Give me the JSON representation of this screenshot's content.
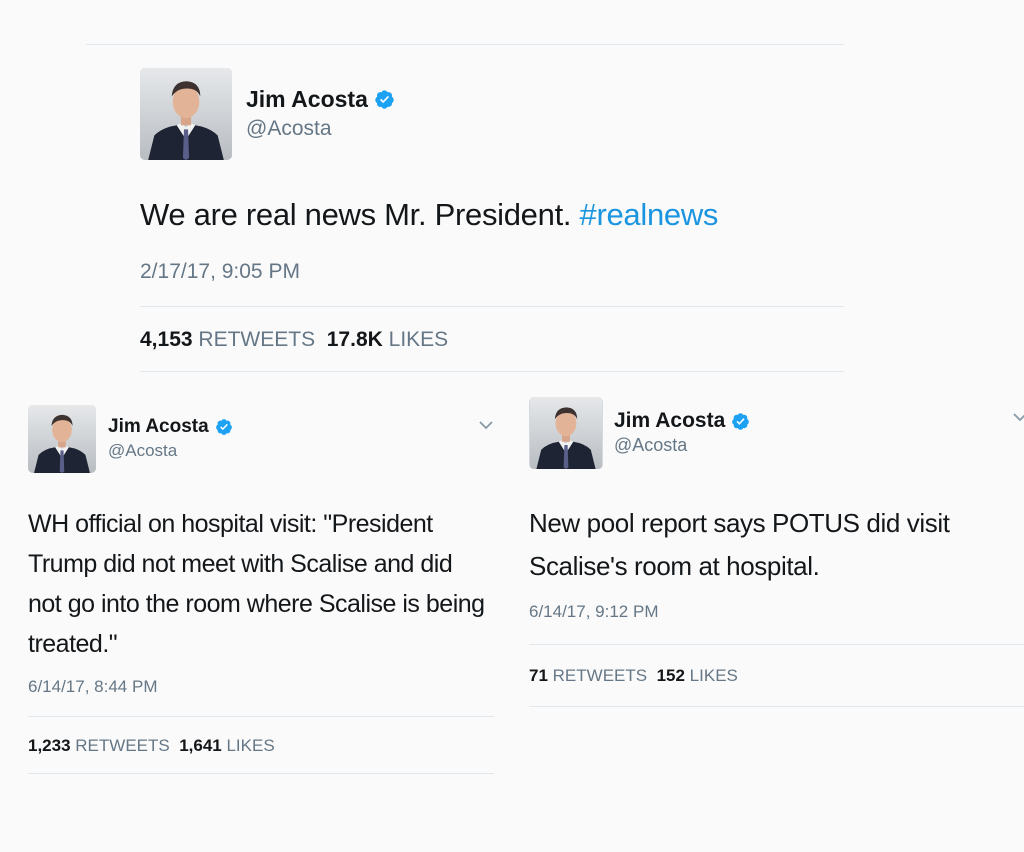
{
  "tweets": [
    {
      "name": "Jim Acosta",
      "handle": "@Acosta",
      "text": "We are real news Mr. President.",
      "hashtag": "#realnews",
      "timestamp": "2/17/17, 9:05 PM",
      "retweets": "4,153",
      "retweets_label": "RETWEETS",
      "likes": "17.8K",
      "likes_label": "LIKES",
      "verified_icon": "verified-badge-icon"
    },
    {
      "name": "Jim Acosta",
      "handle": "@Acosta",
      "text": "WH official on hospital visit: \"President Trump did not meet with Scalise and did not go into the room where Scalise is being treated.\"",
      "timestamp": "6/14/17, 8:44 PM",
      "retweets": "1,233",
      "retweets_label": "RETWEETS",
      "likes": "1,641",
      "likes_label": "LIKES",
      "verified_icon": "verified-badge-icon",
      "menu_icon": "chevron-down-icon"
    },
    {
      "name": "Jim Acosta",
      "handle": "@Acosta",
      "text": "New pool report says POTUS did visit Scalise's room at hospital.",
      "timestamp": "6/14/17, 9:12 PM",
      "retweets": "71",
      "retweets_label": "RETWEETS",
      "likes": "152",
      "likes_label": "LIKES",
      "verified_icon": "verified-badge-icon",
      "menu_icon": "chevron-down-icon"
    }
  ],
  "colors": {
    "link": "#1b95e0",
    "secondary_text": "#657786",
    "divider": "#e1e8ed",
    "verified": "#1da1f2"
  }
}
